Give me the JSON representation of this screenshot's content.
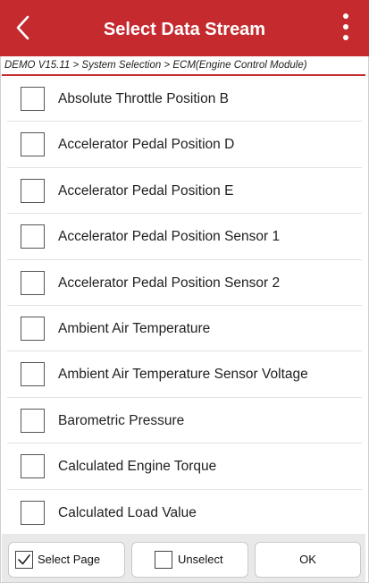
{
  "header": {
    "title": "Select Data Stream",
    "accent_color": "#c42a2e",
    "back_icon": "chevron-left-icon",
    "menu_icon": "more-vertical-icon"
  },
  "breadcrumb": "DEMO V15.11 > System Selection > ECM(Engine Control Module)",
  "list": {
    "items": [
      {
        "label": "Absolute Throttle Position B",
        "checked": false
      },
      {
        "label": "Accelerator Pedal Position D",
        "checked": false
      },
      {
        "label": "Accelerator Pedal Position E",
        "checked": false
      },
      {
        "label": "Accelerator Pedal Position Sensor 1",
        "checked": false
      },
      {
        "label": "Accelerator Pedal Position Sensor 2",
        "checked": false
      },
      {
        "label": "Ambient Air Temperature",
        "checked": false
      },
      {
        "label": "Ambient Air Temperature Sensor Voltage",
        "checked": false
      },
      {
        "label": "Barometric Pressure",
        "checked": false
      },
      {
        "label": "Calculated Engine Torque",
        "checked": false
      },
      {
        "label": "Calculated Load Value",
        "checked": false
      }
    ]
  },
  "footer": {
    "select_page_label": "Select Page",
    "select_page_checked": true,
    "unselect_label": "Unselect",
    "unselect_checked": false,
    "ok_label": "OK"
  }
}
